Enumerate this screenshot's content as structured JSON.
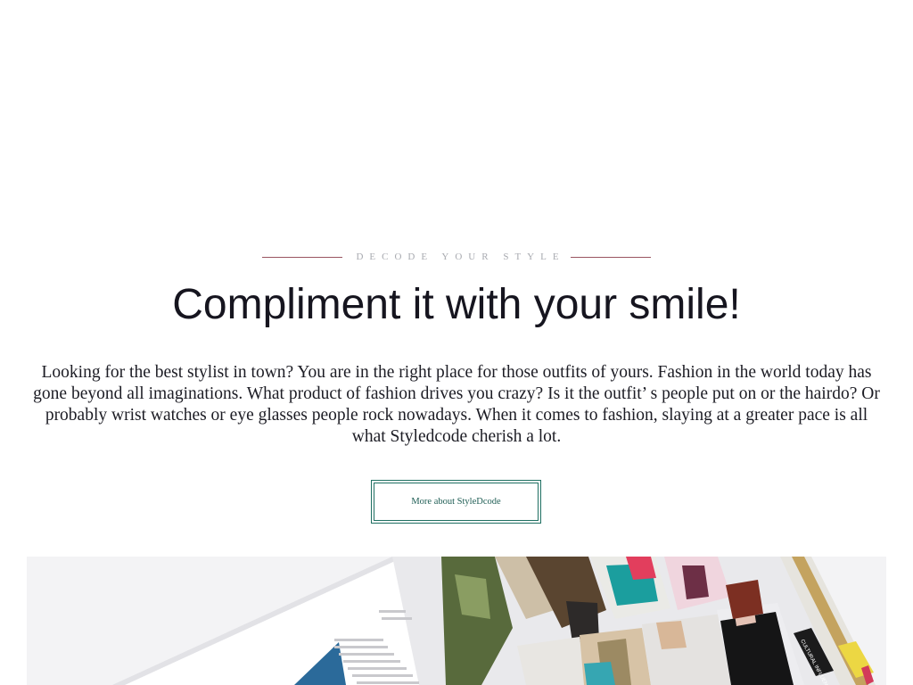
{
  "section": {
    "eyebrow": "DECODE YOUR STYLE",
    "heading": "Compliment it with your smile!",
    "body": "Looking for the best stylist in town? You are in the right place for those outfits of yours. Fashion in the world today has gone beyond all imaginations. What product of fashion drives you crazy? Is it the outfit’ s people put on or the hairdo? Or probably wrist watches or eye glasses people rock nowadays. When it comes to fashion, slaying at a greater pace is all what Styledcode cherish a lot.",
    "cta_label": "More about StyleDcode"
  },
  "colors": {
    "accent_line": "#9a5560",
    "button_border": "#1f6f62",
    "heading": "#16151f",
    "eyebrow": "#a8aab0"
  },
  "hero_image": {
    "side_label": "CULTURAL INFLUENCES"
  }
}
